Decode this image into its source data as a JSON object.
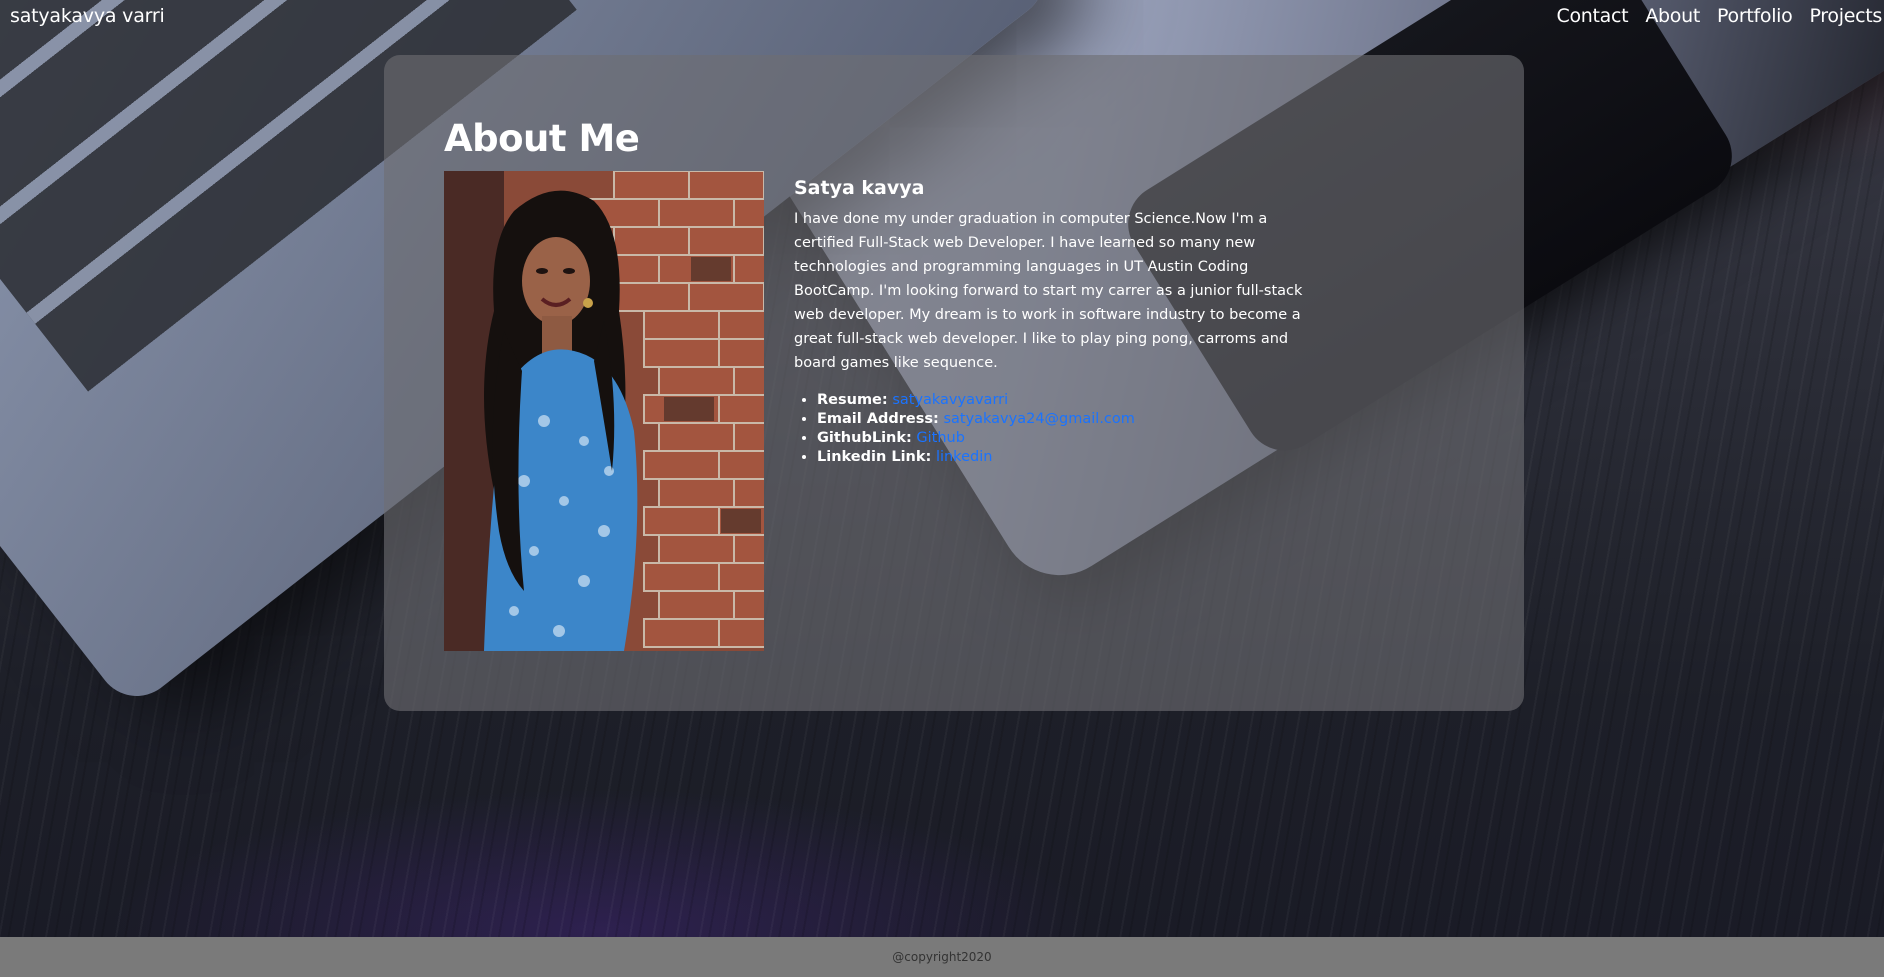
{
  "navbar": {
    "brand": "satyakavya varri",
    "links": [
      "Contact",
      "About",
      "Portfolio",
      "Projects"
    ]
  },
  "about": {
    "heading": "About Me",
    "name": "Satya kavya",
    "bio": "I have done my under graduation in computer Science.Now I'm a certified Full-Stack web Developer. I have learned so many new technologies and programming languages in UT Austin Coding BootCamp. I'm looking forward to start my carrer as a junior full-stack web developer. My dream is to work in software industry to become a great full-stack web developer. I like to play ping pong, carroms and board games like sequence.",
    "links": [
      {
        "label": "Resume:",
        "text": "satyakavyavarri"
      },
      {
        "label": "Email Address:",
        "text": "satyakavya24@gmail.com"
      },
      {
        "label": "GithubLink:",
        "text": "Github"
      },
      {
        "label": "Linkedin Link:",
        "text": "linkedin"
      }
    ]
  },
  "footer": {
    "text": "@copyright2020"
  },
  "colors": {
    "link": "#1a73ff",
    "footer_bg": "#7a7a7a",
    "card_bg": "rgba(110,110,115,0.62)"
  }
}
